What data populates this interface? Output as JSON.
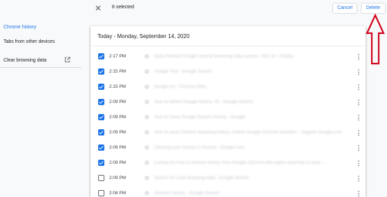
{
  "toolbar": {
    "close_icon": "close-icon",
    "selected_text": "8 selected",
    "cancel_label": "Cancel",
    "delete_label": "Delete"
  },
  "sidebar": {
    "items": [
      {
        "label": "Chrome history",
        "active": true
      },
      {
        "label": "Tabs from other devices",
        "active": false
      },
      {
        "label": "Clear browsing data",
        "active": false,
        "icon": "open-in-new-icon"
      }
    ]
  },
  "history": {
    "date_header": "Today - Monday, September 14, 2020",
    "rows": [
      {
        "time": "2:17 PM",
        "checked": true,
        "title": "Data Fetched Google chrome browsing data ourced - Hint 10 - Simply..."
      },
      {
        "time": "2:15 PM",
        "checked": true,
        "title": "Google Test - Google Search"
      },
      {
        "time": "2:15 PM",
        "checked": true,
        "title": "Google Ad - Chrome Web..."
      },
      {
        "time": "2:09 PM",
        "checked": true,
        "title": "How to delete Google history: All - Google Search"
      },
      {
        "time": "2:09 PM",
        "checked": true,
        "title": "How to Clear Google Search History - Google"
      },
      {
        "time": "2:09 PM",
        "checked": true,
        "title": "How to clear Chrome browsing history: Delete Google Chrome activities - Support Google.com"
      },
      {
        "time": "2:09 PM",
        "checked": true,
        "title": "Clearing your history in chrome - Google.com"
      },
      {
        "time": "2:09 PM",
        "checked": true,
        "title": "Lookup for how to remove history from Google Chrome with option and how to clear ..."
      },
      {
        "time": "2:09 PM",
        "checked": false,
        "title": "Search for clear browsing data - Google Search"
      },
      {
        "time": "2:08 PM",
        "checked": false,
        "title": "Chrome History - Google Search"
      }
    ]
  },
  "colors": {
    "accent": "#1a73e8",
    "annotation_arrow": "#d0021b"
  }
}
